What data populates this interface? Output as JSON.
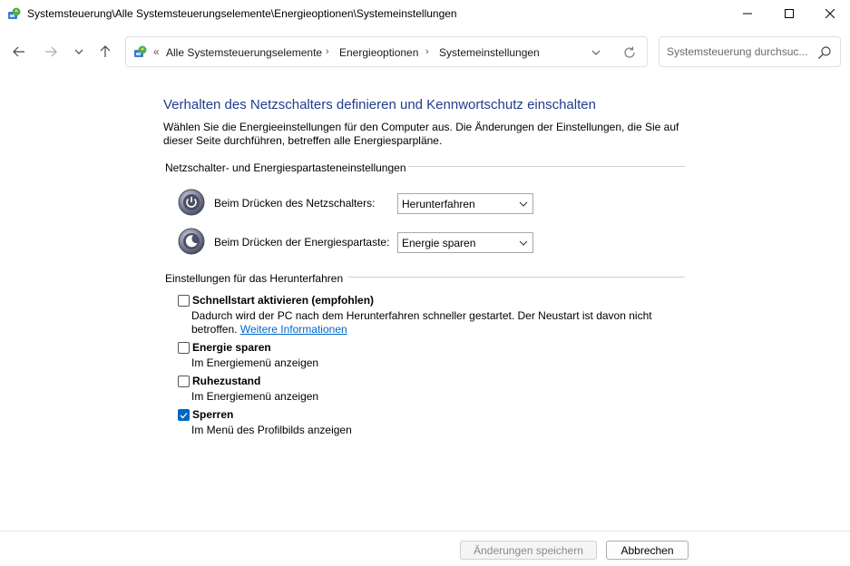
{
  "window": {
    "title": "Systemsteuerung\\Alle Systemsteuerungselemente\\Energieoptionen\\Systemeinstellungen"
  },
  "address": {
    "overflow": "«",
    "crumbs": [
      "Alle Systemsteuerungselemente",
      "Energieoptionen",
      "Systemeinstellungen"
    ],
    "separator": "›"
  },
  "search": {
    "placeholder": "Systemsteuerung durchsuc..."
  },
  "main": {
    "title": "Verhalten des Netzschalters definieren und Kennwortschutz einschalten",
    "description": "Wählen Sie die Energieeinstellungen für den Computer aus. Die Änderungen der Einstellungen, die Sie auf dieser Seite durchführen, betreffen alle Energiesparpläne.",
    "power_group": {
      "heading": "Netzschalter- und Energiespartasteneinstellungen",
      "power_button_label": "Beim Drücken des Netzschalters:",
      "power_button_value": "Herunterfahren",
      "sleep_button_label": "Beim Drücken der Energiespartaste:",
      "sleep_button_value": "Energie sparen"
    },
    "shutdown_group": {
      "heading": "Einstellungen für das Herunterfahren",
      "fast_startup": {
        "title": "Schnellstart aktivieren (empfohlen)",
        "desc": "Dadurch wird der PC nach dem Herunterfahren schneller gestartet. Der Neustart ist davon nicht betroffen.",
        "link": "Weitere Informationen",
        "checked": false
      },
      "sleep": {
        "title": "Energie sparen",
        "desc": "Im Energiemenü anzeigen",
        "checked": false
      },
      "hibernate": {
        "title": "Ruhezustand",
        "desc": "Im Energiemenü anzeigen",
        "checked": false
      },
      "lock": {
        "title": "Sperren",
        "desc": "Im Menü des Profilbilds anzeigen",
        "checked": true
      }
    }
  },
  "footer": {
    "save_label": "Änderungen speichern",
    "cancel_label": "Abbrechen"
  },
  "colors": {
    "title_blue": "#1f3d8c",
    "link_blue": "#0066cc",
    "checkbox_accent": "#0067c0"
  }
}
